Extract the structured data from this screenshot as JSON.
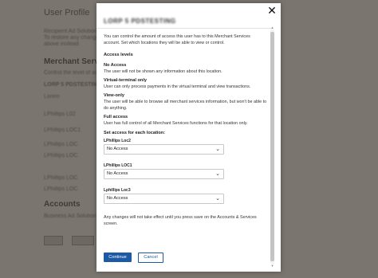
{
  "background": {
    "page_title": "User Profile",
    "intro_lines": [
      "Recipient Ad Solution",
      "To restore any change",
      "above instead"
    ],
    "section_heading": "Merchant Services",
    "subtext": "Control the level of access",
    "merchant_name": "LORP 5 PDSTESTING",
    "rows": [
      "Lorem",
      "LPhillips L02",
      "LPhillips LOC1",
      "LPhillips LOC",
      "LPhillips LOC",
      "LPhillips LOC",
      "LPhillips LOC"
    ],
    "accounts_heading": "Accounts",
    "accounts_text": "Business Ad Solutions"
  },
  "modal": {
    "title": "LORP 5 PDSTESTING",
    "intro": "You can control the amount of access this user has to this Merchant Services account. Set which locations they will be able to view or control.",
    "access_levels_heading": "Access levels",
    "levels": [
      {
        "name": "No Access",
        "desc": "The user will not be shown any information about this location."
      },
      {
        "name": "Virtual-terminal only",
        "desc": "User can only process payments in the virtual terminal and view transactions."
      },
      {
        "name": "View-only",
        "desc": "The user will be able to browse all merchant services information, but won't be able to do anything."
      },
      {
        "name": "Full access",
        "desc": "User has full control of all Merchant Services functions for that location only."
      }
    ],
    "set_access_heading": "Set access for each location:",
    "locations": [
      {
        "label": "LPhillips Loc2",
        "value": "No Access"
      },
      {
        "label": "LPhillips LOC1",
        "value": "No Access"
      },
      {
        "label": "Lphillips Loc3",
        "value": "No Access"
      }
    ],
    "footer_note": "Any changes will not take effect until you press save on the Accounts & Services screen.",
    "continue_label": "Continue",
    "cancel_label": "Cancel",
    "close_symbol": "✕"
  },
  "colors": {
    "primary": "#1c5aa6",
    "overlay": "#7b756f"
  }
}
